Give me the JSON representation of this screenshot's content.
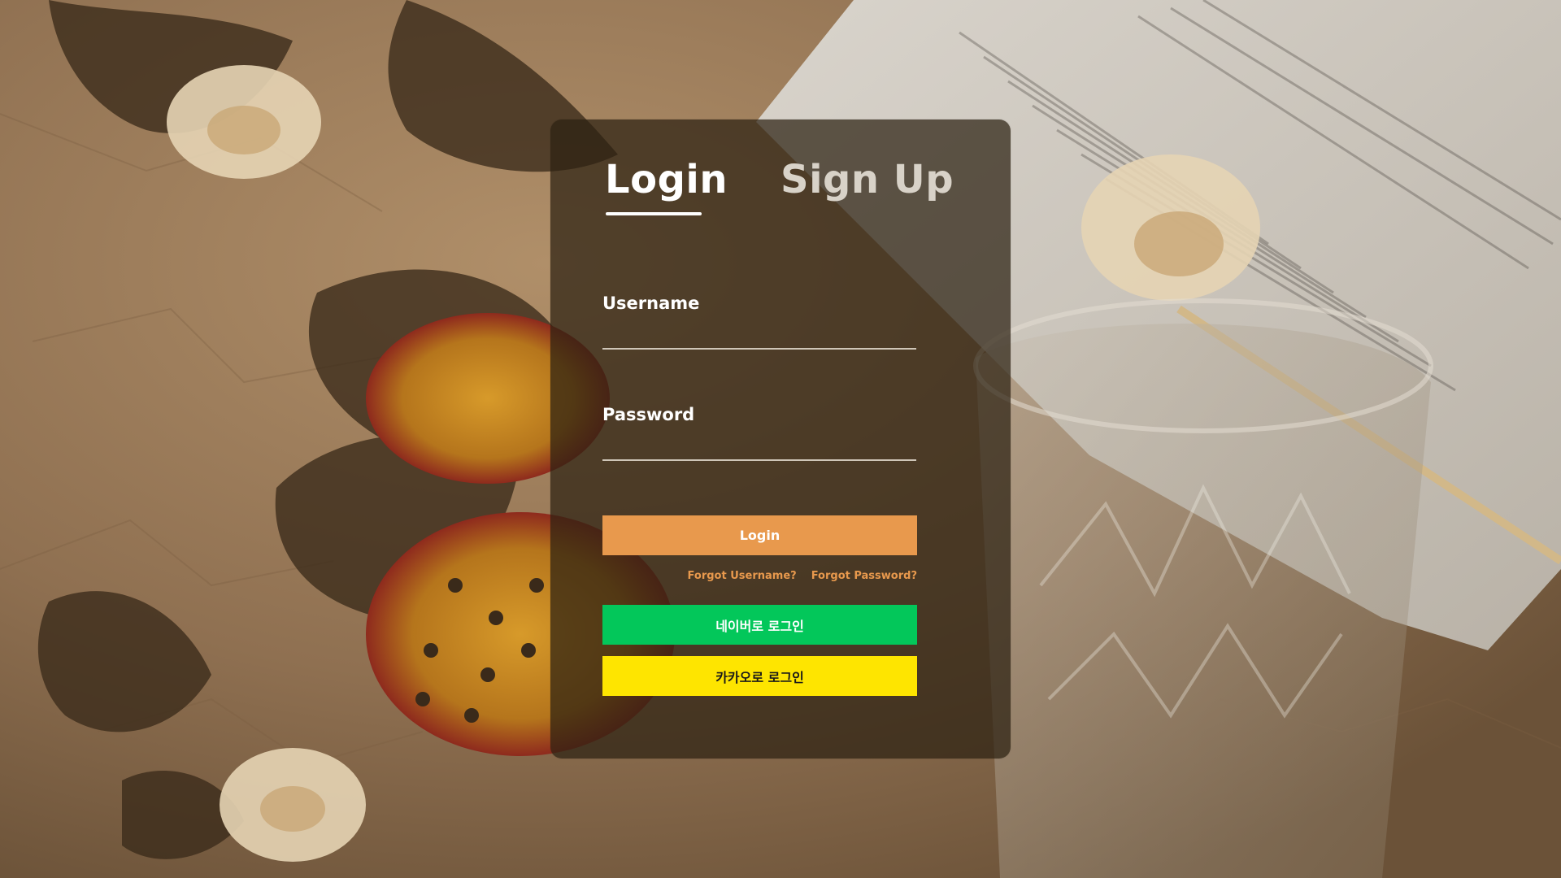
{
  "tabs": {
    "login": "Login",
    "signup": "Sign Up"
  },
  "form": {
    "username_label": "Username",
    "username_value": "",
    "password_label": "Password",
    "password_value": ""
  },
  "buttons": {
    "login": "Login",
    "naver": "네이버로 로그인",
    "kakao": "카카오로 로그인"
  },
  "links": {
    "forgot_username": "Forgot Username?",
    "forgot_password": "Forgot Password?"
  },
  "colors": {
    "accent": "#e8994d",
    "naver": "#03c75a",
    "kakao": "#fee500",
    "card_overlay": "rgba(44,33,18,0.72)"
  }
}
